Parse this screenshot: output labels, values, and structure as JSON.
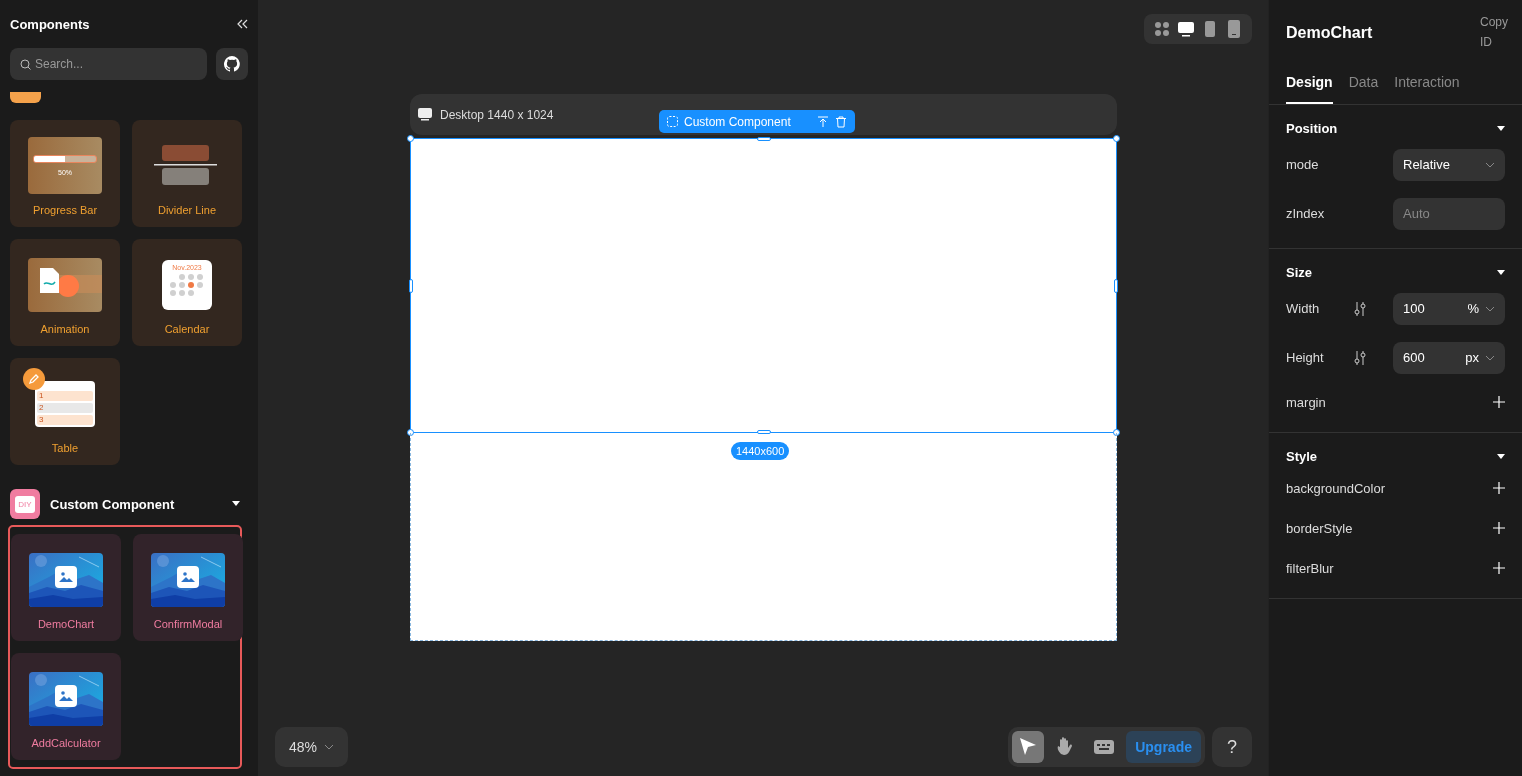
{
  "sidebar": {
    "title": "Components",
    "search": {
      "placeholder": "Search..."
    },
    "items": [
      {
        "label": "Progress Bar",
        "kind": "progress",
        "thumb_text": "50%",
        "level": 0.5
      },
      {
        "label": "Divider Line",
        "kind": "divider"
      },
      {
        "label": "Animation",
        "kind": "animation"
      },
      {
        "label": "Calendar",
        "kind": "calendar",
        "thumb_text": "Nov.2023"
      },
      {
        "label": "Table",
        "kind": "table",
        "row_numbers": [
          "1",
          "2",
          "3"
        ]
      }
    ],
    "custom_section": {
      "badge": "DIY",
      "title": "Custom Component",
      "expanded": true,
      "items": [
        {
          "label": "DemoChart",
          "kind": "picture"
        },
        {
          "label": "ConfirmModal",
          "kind": "picture"
        },
        {
          "label": "AddCalculator",
          "kind": "picture"
        }
      ]
    }
  },
  "canvas": {
    "devices": [
      {
        "kind": "grid",
        "selected": false
      },
      {
        "kind": "desktop",
        "selected": true
      },
      {
        "kind": "phone",
        "selected": false
      },
      {
        "kind": "tablet",
        "selected": false
      }
    ],
    "frame_title": "Desktop 1440 x 1024",
    "selection_tag": "Custom Component",
    "size_badge": "1440x600",
    "zoom": "48%",
    "tools": [
      {
        "kind": "pointer",
        "selected": true
      },
      {
        "kind": "hand",
        "selected": false
      },
      {
        "kind": "keyboard",
        "selected": false
      }
    ],
    "upgrade": "Upgrade",
    "help": "?"
  },
  "inspector": {
    "title": "DemoChart",
    "copy_id": "Copy ID",
    "tabs": [
      {
        "label": "Design",
        "selected": true
      },
      {
        "label": "Data",
        "selected": false
      },
      {
        "label": "Interaction",
        "selected": false
      }
    ],
    "sections": [
      {
        "title": "Position",
        "expanded": true,
        "rows": [
          {
            "label": "mode",
            "kind": "select",
            "value": "Relative"
          },
          {
            "label": "zIndex",
            "kind": "input",
            "placeholder": "Auto"
          }
        ]
      },
      {
        "title": "Size",
        "expanded": true,
        "rows": [
          {
            "label": "Width",
            "kind": "unit",
            "value": "100",
            "unit": "%"
          },
          {
            "label": "Height",
            "kind": "unit",
            "value": "600",
            "unit": "px"
          },
          {
            "label": "margin",
            "kind": "add"
          }
        ]
      },
      {
        "title": "Style",
        "expanded": true,
        "rows": [
          {
            "label": "backgroundColor",
            "kind": "add"
          },
          {
            "label": "borderStyle",
            "kind": "add"
          },
          {
            "label": "filterBlur",
            "kind": "add"
          }
        ]
      }
    ]
  }
}
